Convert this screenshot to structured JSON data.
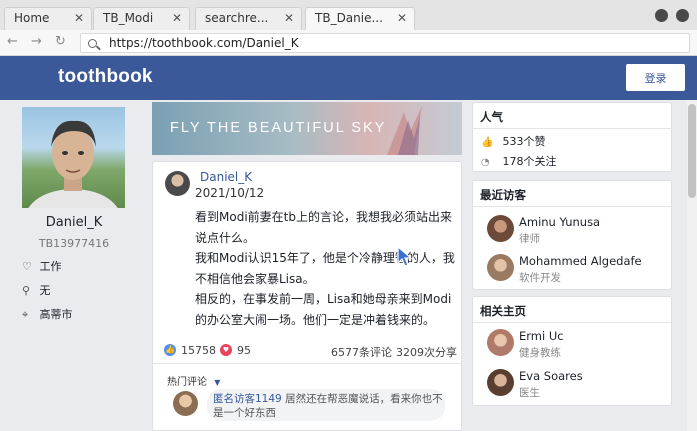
{
  "browser": {
    "tabs": [
      {
        "label": "Home"
      },
      {
        "label": "TB_Modi"
      },
      {
        "label": "searchre..."
      },
      {
        "label": "TB_Danie..."
      }
    ],
    "url": "https://toothbook.com/Daniel_K"
  },
  "site": {
    "logo": "toothbook",
    "login_label": "登录"
  },
  "profile": {
    "name": "Daniel_K",
    "id": "TB13977416",
    "job": "工作",
    "relation": "无",
    "city": "高蒂市"
  },
  "banner": {
    "text": "FLY THE BEAUTIFUL SKY"
  },
  "post": {
    "author": "Daniel_K",
    "date": "2021/10/12",
    "paragraphs": [
      "看到Modi前妻在tb上的言论，我想我必须站出来说点什么。",
      "我和Modi认识15年了，他是个冷静理智的人，我不相信他会家暴Lisa。",
      "相反的，在事发前一周，Lisa和她母亲来到Modi的办公室大闹一场。他们一定是冲着钱来的。"
    ],
    "likes": "15758",
    "hearts": "95",
    "comments": "6577条评论",
    "shares": "3209次分享",
    "hot_comments_label": "热门评论",
    "top_comment": {
      "author": "匿名访客1149",
      "text": "居然还在帮恶魔说话，看来你也不是一个好东西"
    }
  },
  "popularity": {
    "title": "人气",
    "likes": "533个赞",
    "follows": "178个关注"
  },
  "recent_visitors": {
    "title": "最近访客",
    "items": [
      {
        "name": "Aminu Yunusa",
        "role": "律师"
      },
      {
        "name": "Mohammed Algedafe",
        "role": "软件开发"
      }
    ]
  },
  "related_pages": {
    "title": "相关主页",
    "items": [
      {
        "name": "Ermi Uc",
        "role": "健身教练"
      },
      {
        "name": "Eva Soares",
        "role": "医生"
      }
    ]
  },
  "colors": {
    "brand": "#3b5998",
    "link": "#365899"
  }
}
